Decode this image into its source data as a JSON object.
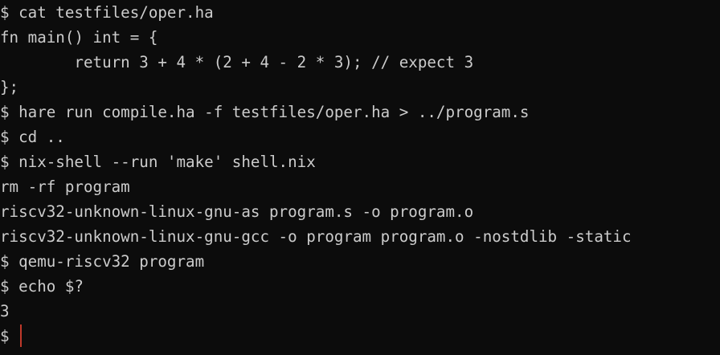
{
  "terminal": {
    "lines": [
      "$ cat testfiles/oper.ha",
      "fn main() int = {",
      "        return 3 + 4 * (2 + 4 - 2 * 3); // expect 3",
      "};",
      "$ hare run compile.ha -f testfiles/oper.ha > ../program.s",
      "$ cd ..",
      "$ nix-shell --run 'make' shell.nix",
      "rm -rf program",
      "riscv32-unknown-linux-gnu-as program.s -o program.o",
      "riscv32-unknown-linux-gnu-gcc -o program program.o -nostdlib -static",
      "$ qemu-riscv32 program",
      "$ echo $?",
      "3"
    ],
    "prompt": "$ "
  },
  "colors": {
    "background": "#0c0c0c",
    "foreground": "#cccccc",
    "cursor": "#c0392b"
  }
}
